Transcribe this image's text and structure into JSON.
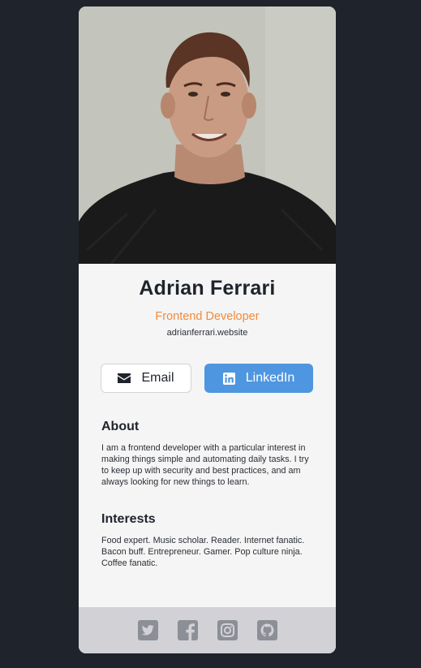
{
  "profile": {
    "name": "Adrian Ferrari",
    "title": "Frontend Developer",
    "website": "adrianferrari.website"
  },
  "buttons": {
    "email_label": "Email",
    "linkedin_label": "LinkedIn"
  },
  "about": {
    "heading": "About",
    "text": "I am a frontend developer with a particular interest in making things simple and automating daily tasks. I try to keep up with security and best practices, and am always looking for new things to learn."
  },
  "interests": {
    "heading": "Interests",
    "text": "Food expert. Music scholar. Reader. Internet fanatic. Bacon buff. Entrepreneur. Gamer. Pop culture ninja. Coffee fanatic."
  },
  "footer": {
    "icons": [
      "twitter-icon",
      "facebook-icon",
      "instagram-icon",
      "github-icon"
    ]
  },
  "colors": {
    "background": "#1f232b",
    "card": "#f5f5f5",
    "accent_orange": "#f08a3c",
    "linkedin_blue": "#4f96e0",
    "footer": "#d1d1d6",
    "footer_icon": "#8d8f96"
  }
}
